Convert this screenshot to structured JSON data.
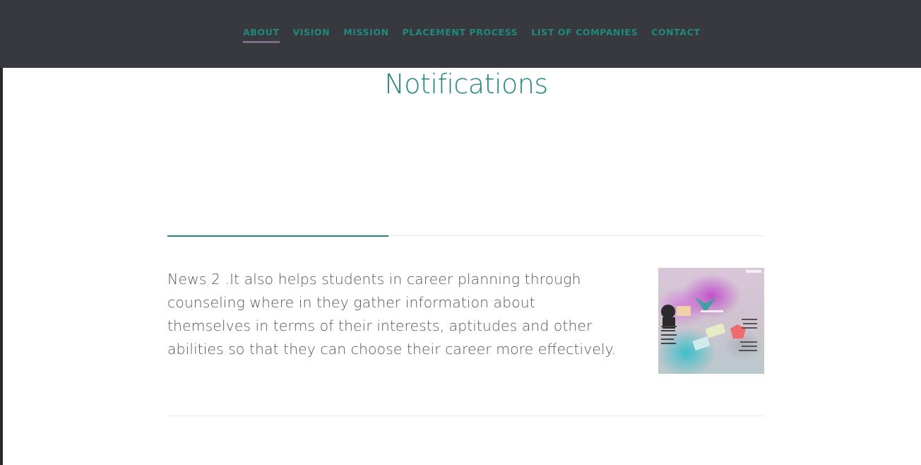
{
  "nav": {
    "items": [
      {
        "label": "ABOUT",
        "active": true
      },
      {
        "label": "VISION",
        "active": false
      },
      {
        "label": "MISSION",
        "active": false
      },
      {
        "label": "PLACEMENT PROCESS",
        "active": false
      },
      {
        "label": "LIST OF COMPANIES",
        "active": false
      },
      {
        "label": "CONTACT",
        "active": false
      }
    ]
  },
  "main": {
    "title": "Notifications",
    "news": {
      "text": "News 2 .It also helps students in career planning through counseling where in they gather information about themselves in terms of their interests, aptitudes and other abilities so that they can choose their career more effectively."
    }
  },
  "colors": {
    "navbar_bg": "#37393e",
    "accent_teal": "#1e8a7c",
    "active_underline": "#7c6f86",
    "body_text": "#55575c"
  }
}
